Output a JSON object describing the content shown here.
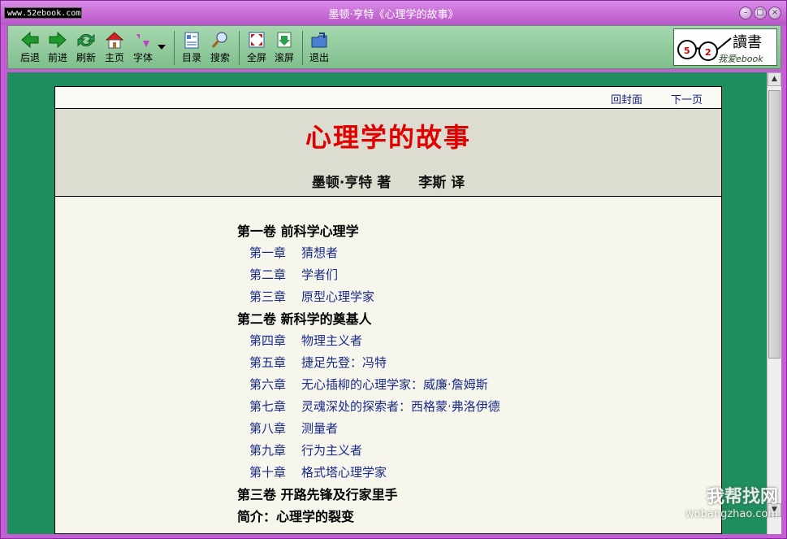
{
  "window": {
    "title": "墨顿·亨特《心理学的故事》",
    "site_logo": "www.52ebook.com",
    "controls": [
      "●",
      "●",
      "●"
    ]
  },
  "toolbar": {
    "buttons": [
      {
        "label": "后退",
        "icon": "back-arrow-icon"
      },
      {
        "label": "前进",
        "icon": "forward-arrow-icon"
      },
      {
        "label": "刷新",
        "icon": "refresh-icon"
      },
      {
        "label": "主页",
        "icon": "home-icon"
      },
      {
        "label": "字体",
        "icon": "font-icon"
      },
      {
        "label": "目录",
        "icon": "toc-icon"
      },
      {
        "label": "搜索",
        "icon": "search-icon"
      },
      {
        "label": "全屏",
        "icon": "fullscreen-icon"
      },
      {
        "label": "滚屏",
        "icon": "scroll-icon"
      },
      {
        "label": "退出",
        "icon": "exit-icon"
      }
    ],
    "brand": {
      "text1": "讀書",
      "text2": "我爱ebook",
      "badge1": "5",
      "badge2": "2"
    }
  },
  "page": {
    "nav": {
      "cover": "回封面",
      "next": "下一页"
    },
    "title": "心理学的故事",
    "author_line": "墨顿·亨特 著　　李斯 译",
    "toc": [
      {
        "type": "vol",
        "text": "第一卷  前科学心理学"
      },
      {
        "type": "chap",
        "num": "第一章",
        "text": "猜想者"
      },
      {
        "type": "chap",
        "num": "第二章",
        "text": "学者们"
      },
      {
        "type": "chap",
        "num": "第三章",
        "text": "原型心理学家"
      },
      {
        "type": "vol",
        "text": "第二卷  新科学的奠基人"
      },
      {
        "type": "chap",
        "num": "第四章",
        "text": "物理主义者"
      },
      {
        "type": "chap",
        "num": "第五章",
        "text": "捷足先登：冯特"
      },
      {
        "type": "chap",
        "num": "第六章",
        "text": "无心插柳的心理学家：威廉·詹姆斯"
      },
      {
        "type": "chap",
        "num": "第七章",
        "text": "灵魂深处的探索者：西格蒙·弗洛伊德"
      },
      {
        "type": "chap",
        "num": "第八章",
        "text": "测量者"
      },
      {
        "type": "chap",
        "num": "第九章",
        "text": "行为主义者"
      },
      {
        "type": "chap",
        "num": "第十章",
        "text": "格式塔心理学家"
      },
      {
        "type": "vol",
        "text": "第三卷  开路先锋及行家里手"
      },
      {
        "type": "vol",
        "text": "简介：心理学的裂变"
      }
    ]
  },
  "scrollbar": {
    "up": "▲",
    "down": "▼"
  },
  "watermark": {
    "line1": "我帮找网",
    "line2": "wobangzhao.com"
  }
}
